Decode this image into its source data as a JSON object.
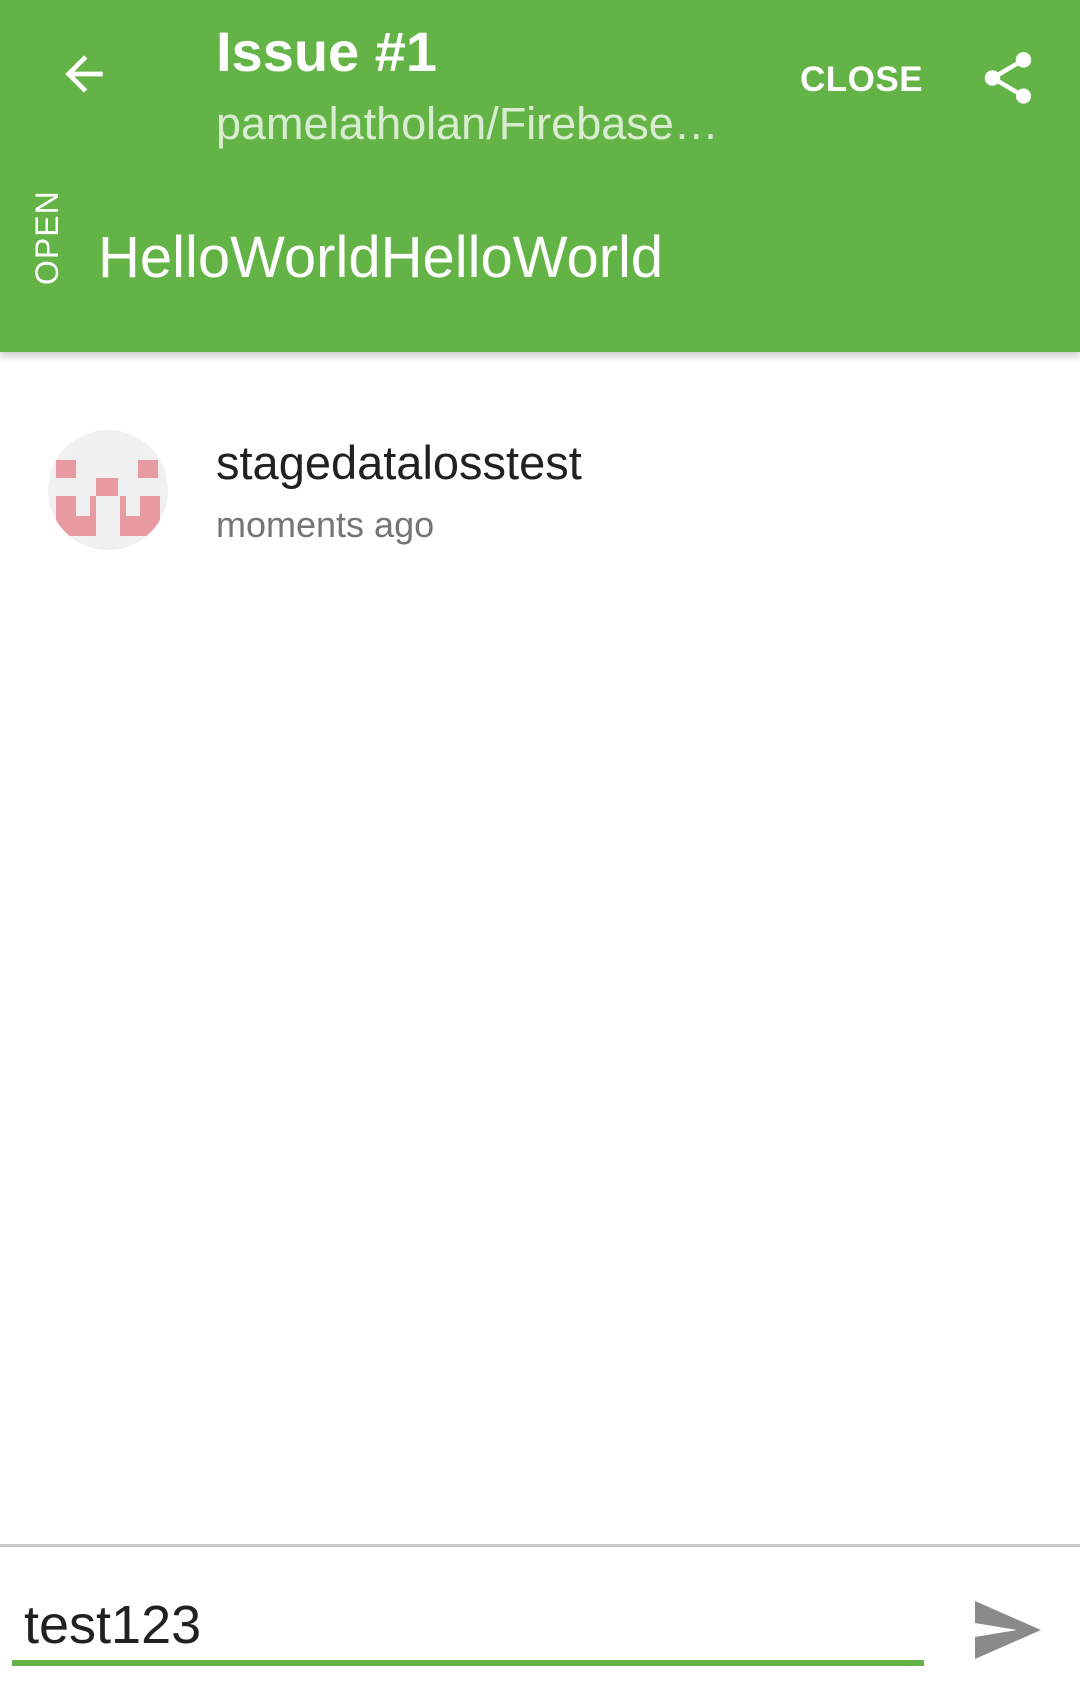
{
  "header": {
    "title": "Issue #1",
    "subtitle": "pamelatholan/Firebase…",
    "close_label": "CLOSE",
    "back_icon": "arrow-left-icon",
    "share_icon": "share-icon",
    "status": "OPEN",
    "issue_title": "HelloWorldHelloWorld",
    "color": "#64b346"
  },
  "comments": [
    {
      "author": "stagedatalosstest",
      "time": "moments ago",
      "avatar_icon": "identicon-avatar",
      "avatar_color": "#e89aa2"
    }
  ],
  "composer": {
    "value": "test123",
    "send_icon": "send-icon",
    "accent": "#64b346"
  }
}
